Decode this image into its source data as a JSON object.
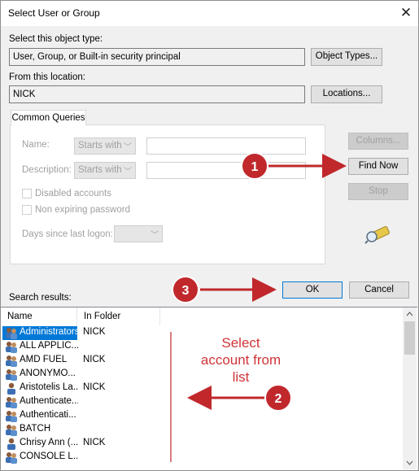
{
  "window": {
    "title": "Select User or Group",
    "close_glyph": "✕"
  },
  "object_type": {
    "label": "Select this object type:",
    "value": "User, Group, or Built-in security principal",
    "button": "Object Types..."
  },
  "location": {
    "label": "From this location:",
    "value": "NICK",
    "button": "Locations..."
  },
  "queries": {
    "tab": "Common Queries",
    "name_label": "Name:",
    "name_mode": "Starts with",
    "description_label": "Description:",
    "description_mode": "Starts with",
    "disabled_label": "Disabled accounts",
    "nonexpiring_label": "Non expiring password",
    "days_label": "Days since last logon:"
  },
  "buttons": {
    "columns": "Columns...",
    "find_now": "Find Now",
    "stop": "Stop",
    "ok": "OK",
    "cancel": "Cancel"
  },
  "results": {
    "label": "Search results:",
    "headers": [
      "Name",
      "In Folder"
    ],
    "rows": [
      {
        "name": "Administrators",
        "folder": "NICK",
        "icon": "group-icon"
      },
      {
        "name": "ALL APPLIC...",
        "folder": "",
        "icon": "group-icon"
      },
      {
        "name": "AMD FUEL",
        "folder": "NICK",
        "icon": "group-icon"
      },
      {
        "name": "ANONYMO...",
        "folder": "",
        "icon": "group-icon"
      },
      {
        "name": "Aristotelis La...",
        "folder": "NICK",
        "icon": "user-icon"
      },
      {
        "name": "Authenticate...",
        "folder": "",
        "icon": "group-icon"
      },
      {
        "name": "Authenticati...",
        "folder": "",
        "icon": "group-icon"
      },
      {
        "name": "BATCH",
        "folder": "",
        "icon": "group-icon"
      },
      {
        "name": "Chrisy Ann (...",
        "folder": "NICK",
        "icon": "user-icon"
      },
      {
        "name": "CONSOLE L...",
        "folder": "",
        "icon": "group-icon"
      }
    ]
  },
  "annotations": {
    "step1": "1",
    "step2": "2",
    "step3": "3",
    "note": "Select account from list",
    "color": "#c0282c"
  }
}
